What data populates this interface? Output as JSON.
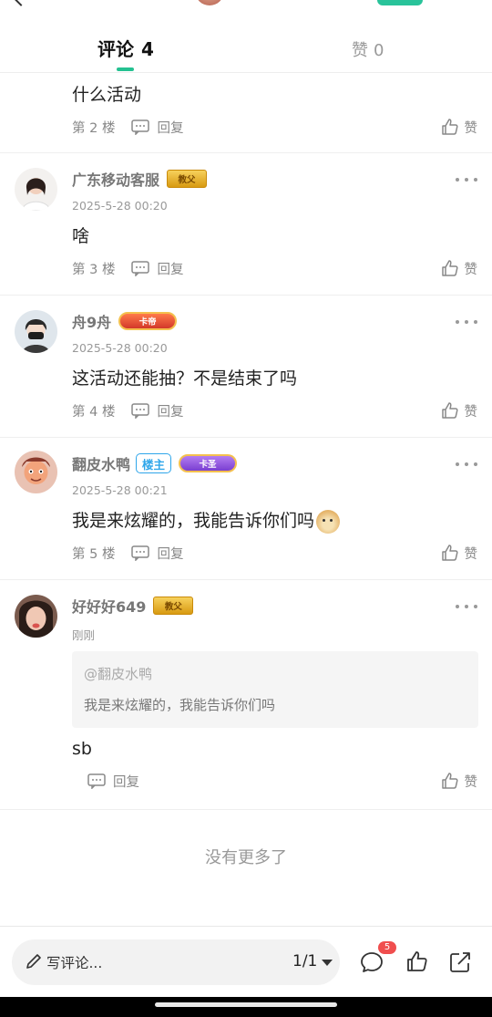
{
  "tabs": {
    "comments_label": "评论",
    "comments_count": "4",
    "likes_label": "赞",
    "likes_count": "0"
  },
  "comments": [
    {
      "content": "什么活动",
      "floor": "第 2 楼",
      "reply_label": "回复",
      "like_label": "赞"
    },
    {
      "username": "广东移动客服",
      "badge": "教父",
      "time": "2025-5-28 00:20",
      "content": "啥",
      "floor": "第 3 楼",
      "reply_label": "回复",
      "like_label": "赞"
    },
    {
      "username": "舟9舟",
      "badge": "卡帝",
      "time": "2025-5-28 00:20",
      "content": "这活动还能抽？不是结束了吗",
      "floor": "第 4 楼",
      "reply_label": "回复",
      "like_label": "赞"
    },
    {
      "username": "翻皮水鸭",
      "host_tag": "楼主",
      "badge": "卡圣",
      "time": "2025-5-28 00:21",
      "content": "我是来炫耀的，我能告诉你们吗",
      "emoji": "doge-emoji",
      "floor": "第 5 楼",
      "reply_label": "回复",
      "like_label": "赞"
    },
    {
      "username": "好好好649",
      "badge": "教父",
      "time": "刚刚",
      "quote": {
        "name": "@翻皮水鸭",
        "text": "我是来炫耀的，我能告诉你们吗"
      },
      "content": "sb",
      "reply_label": "回复",
      "like_label": "赞"
    }
  ],
  "footer_text": "没有更多了",
  "bottom_bar": {
    "placeholder": "写评论...",
    "pager": "1/1",
    "comment_badge": "5",
    "icons": [
      "pen-icon",
      "comment-icon",
      "thumbs-up-icon",
      "share-icon"
    ]
  },
  "colors": {
    "accent": "#24c191",
    "host_tag": "#2fa6ea",
    "notif": "#f04e4e"
  }
}
